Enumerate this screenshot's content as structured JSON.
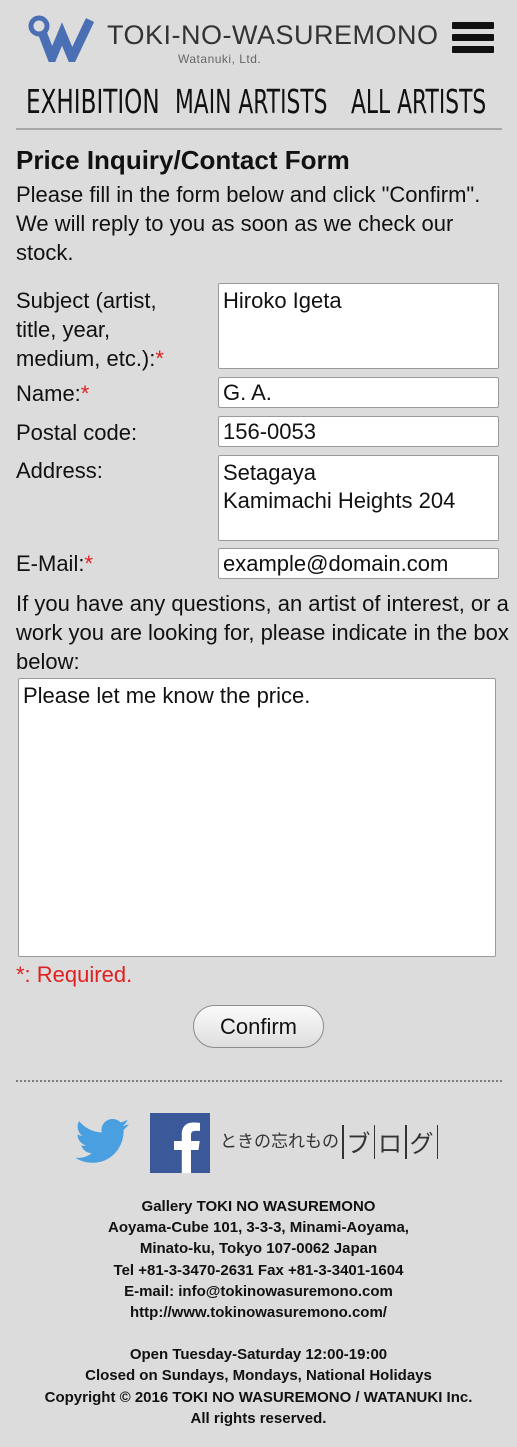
{
  "header": {
    "logo_title": "TOKI-NO-WASUREMONO",
    "logo_subtitle": "Watanuki, Ltd.",
    "nav": [
      "EXHIBITION",
      "MAIN ARTISTS",
      "ALL ARTISTS"
    ]
  },
  "form": {
    "title": "Price Inquiry/Contact Form",
    "intro": "Please fill in the form below and click \"Confirm\". We will reply to you as soon as we check our stock.",
    "fields": [
      {
        "label": "Subject (artist, title, year, medium, etc.):",
        "required_mark": "*",
        "value": "Hiroko Igeta"
      },
      {
        "label": "Name:",
        "required_mark": "*",
        "value": "G. A."
      },
      {
        "label": "Postal code:",
        "required_mark": "",
        "value": "156-0053"
      },
      {
        "label": "Address:",
        "required_mark": "",
        "value": "Setagaya\nKamimachi Heights 204"
      },
      {
        "label": "E-Mail:",
        "required_mark": "*",
        "value": "example@domain.com"
      }
    ],
    "question_prompt": "If you have any questions, an artist of interest, or a work you are looking for, please indicate in the box below:",
    "question_value": "Please let me know the price.",
    "required_note": "*: Required.",
    "confirm_label": "Confirm"
  },
  "social": {
    "blog_label_small": "ときの忘れもの",
    "blog_label_chars": [
      "ブ",
      "ロ",
      "グ"
    ]
  },
  "footer": {
    "lines": [
      "Gallery TOKI NO WASUREMONO",
      "Aoyama-Cube 101, 3-3-3, Minami-Aoyama,",
      "Minato-ku, Tokyo 107-0062 Japan",
      "Tel +81-3-3470-2631 Fax +81-3-3401-1604",
      "E-mail: info@tokinowasuremono.com",
      "http://www.tokinowasuremono.com/"
    ],
    "hours_lines": [
      "Open Tuesday-Saturday 12:00-19:00",
      "Closed on Sundays, Mondays, National Holidays",
      "Copyright © 2016 TOKI NO WASUREMONO / WATANUKI Inc.",
      "All rights reserved."
    ]
  },
  "colors": {
    "background": "#dcdcdc",
    "required": "#e02020",
    "logo_blue": "#4a6fb5",
    "twitter_blue": "#4a9fe0",
    "facebook_blue": "#3b5998"
  }
}
